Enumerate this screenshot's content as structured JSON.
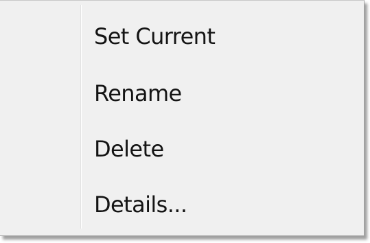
{
  "context_menu": {
    "items": [
      {
        "label": "Set Current"
      },
      {
        "label": "Rename"
      },
      {
        "label": "Delete"
      },
      {
        "label": "Details..."
      }
    ]
  }
}
